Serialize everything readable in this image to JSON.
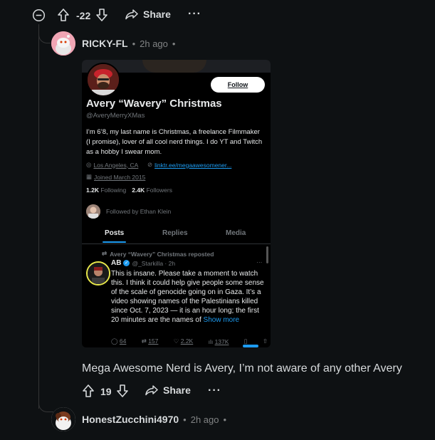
{
  "top_actions": {
    "collapse_icon": "minus-circle-icon",
    "upvote_icon": "arrow-up-icon",
    "vote_count": "-22",
    "downvote_icon": "arrow-down-icon",
    "share_label": "Share",
    "more_label": "···"
  },
  "comment": {
    "username": "RICKY-FL",
    "time": "2h ago",
    "sep1": "•",
    "sep2": "•",
    "text": "Mega Awesome Nerd is Avery, I’m not aware of any other Avery",
    "upvote_icon": "arrow-up-icon",
    "vote_count": "19",
    "downvote_icon": "arrow-down-icon",
    "share_label": "Share",
    "more_label": "···"
  },
  "embedded": {
    "follow_label": "Follow",
    "display_name": "Avery “Wavery” Christmas",
    "handle": "@AveryMerryXMas",
    "bio": "I’m 6’8, my last name is Christmas, a freelance Filmmaker (I promise), lover of all cool nerd things. I do YT and Twitch as a hobby I swear mom.",
    "location": "Los Angeles, CA",
    "link": "linktr.ee/megaawesomener...",
    "joined": "Joined March 2015",
    "following_count": "1.2K",
    "following_label": "Following",
    "followers_count": "2.4K",
    "followers_label": "Followers",
    "followed_by": "Followed by Ethan Klein",
    "tabs": [
      "Posts",
      "Replies",
      "Media"
    ],
    "repost_line": "Avery “Wavery” Christmas reposted",
    "post_author": "AB",
    "post_handle": "@_Starkilla · 2h",
    "post_text": "This is insane. Please take a moment to watch this. I think it could help give people some sense of the scale of genocide going on in Gaza. It’s a video showing names of the Palestinians killed since Oct. 7, 2023 — it is an hour long; the first 20 minutes are the names of",
    "post_show_more": "Show more",
    "stats": {
      "replies": "64",
      "reposts": "157",
      "likes": "2.2K",
      "views": "137K"
    }
  },
  "reply": {
    "username": "HonestZucchini4970",
    "time": "2h ago",
    "sep1": "•",
    "sep2": "•"
  },
  "colors": {
    "background": "#0e1113",
    "text": "#d7dadc",
    "muted": "#818384",
    "twitter_blue": "#1d9bf0"
  }
}
